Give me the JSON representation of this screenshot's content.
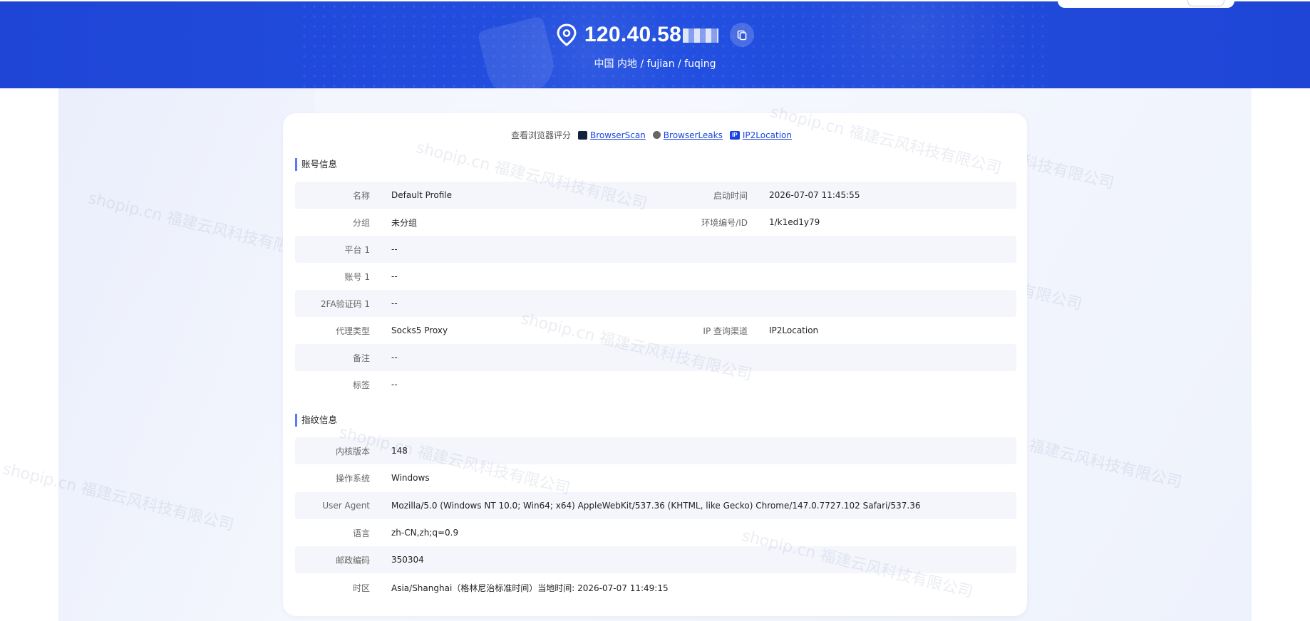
{
  "header": {
    "ip_visible": "120.40.58",
    "location": "中国 内地 / fujian / fuqing"
  },
  "check_links": {
    "label": "查看浏览器评分",
    "items": [
      {
        "name": "BrowserScan",
        "icon": "browserscan-icon"
      },
      {
        "name": "BrowserLeaks",
        "icon": "browserleaks-icon"
      },
      {
        "name": "IP2Location",
        "icon": "ip2location-icon"
      }
    ],
    "ip_icon_text": "IP"
  },
  "account": {
    "title": "账号信息",
    "name_label": "名称",
    "name_value": "Default Profile",
    "start_label": "启动时间",
    "start_value": "2026-07-07 11:45:55",
    "group_label": "分组",
    "group_value": "未分组",
    "env_label": "环境编号/ID",
    "env_value": "1/k1ed1y79",
    "platform_label": "平台 1",
    "platform_value": "--",
    "acct_label": "账号 1",
    "acct_value": "--",
    "twofa_label": "2FA验证码 1",
    "twofa_value": "--",
    "proxy_label": "代理类型",
    "proxy_value": "Socks5 Proxy",
    "ipq_label": "IP 查询渠道",
    "ipq_value": "IP2Location",
    "note_label": "备注",
    "note_value": "--",
    "tag_label": "标签",
    "tag_value": "--"
  },
  "fingerprint": {
    "title": "指纹信息",
    "kernel_label": "内核版本",
    "kernel_value": "148",
    "os_label": "操作系统",
    "os_value": "Windows",
    "ua_label": "User Agent",
    "ua_value": "Mozilla/5.0 (Windows NT 10.0; Win64; x64) AppleWebKit/537.36 (KHTML, like Gecko) Chrome/147.0.7727.102 Safari/537.36",
    "lang_label": "语言",
    "lang_value": "zh-CN,zh;q=0.9",
    "zip_label": "邮政编码",
    "zip_value": "350304",
    "tz_label": "时区",
    "tz_value": "Asia/Shanghai（格林尼治标准时间）当地时间: 2026-07-07 11:49:15"
  },
  "watermark": "shopip.cn 福建云风科技有限公司",
  "colors": {
    "banner": "#1f47d9",
    "link": "#1a44e0",
    "accent": "#5b7cf0"
  }
}
